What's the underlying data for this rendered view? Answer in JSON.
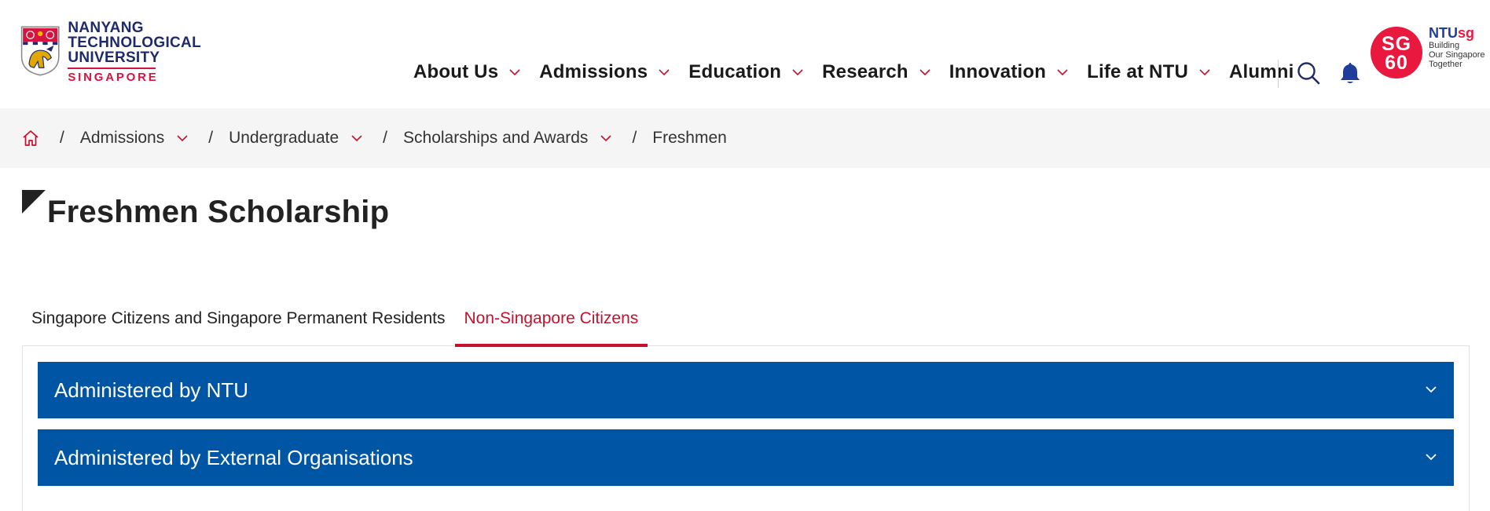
{
  "header": {
    "logo": {
      "lines": [
        "NANYANG",
        "TECHNOLOGICAL",
        "UNIVERSITY"
      ],
      "subline": "SINGAPORE"
    },
    "nav": [
      {
        "label": "About Us",
        "dropdown": true
      },
      {
        "label": "Admissions",
        "dropdown": true
      },
      {
        "label": "Education",
        "dropdown": true
      },
      {
        "label": "Research",
        "dropdown": true
      },
      {
        "label": "Innovation",
        "dropdown": true
      },
      {
        "label": "Life at NTU",
        "dropdown": true
      },
      {
        "label": "Alumni",
        "dropdown": false
      }
    ],
    "icons": {
      "search": "search-icon",
      "notifications": "bell-icon"
    },
    "sg60": {
      "badge_line1": "SG",
      "badge_line2": "60",
      "brand_a": "NTU",
      "brand_b": "sg",
      "tagline": [
        "Building",
        "Our Singapore",
        "Together"
      ]
    }
  },
  "breadcrumb": {
    "home_icon": "home-icon",
    "items": [
      {
        "label": "Admissions",
        "dropdown": true
      },
      {
        "label": "Undergraduate",
        "dropdown": true
      },
      {
        "label": "Scholarships and Awards",
        "dropdown": true
      },
      {
        "label": "Freshmen",
        "dropdown": false
      }
    ]
  },
  "page": {
    "title": "Freshmen Scholarship"
  },
  "tabs": [
    {
      "label": "Singapore Citizens and Singapore Permanent Residents",
      "active": false
    },
    {
      "label": "Non-Singapore Citizens",
      "active": true
    }
  ],
  "accordions": [
    {
      "label": "Administered by NTU",
      "expanded": false
    },
    {
      "label": "Administered by External Organisations",
      "expanded": false
    }
  ],
  "colors": {
    "brand_red": "#c8102e",
    "brand_navy": "#1f2a6b",
    "accordion_blue": "#0055a5",
    "breadcrumb_bg": "#f5f5f5"
  }
}
